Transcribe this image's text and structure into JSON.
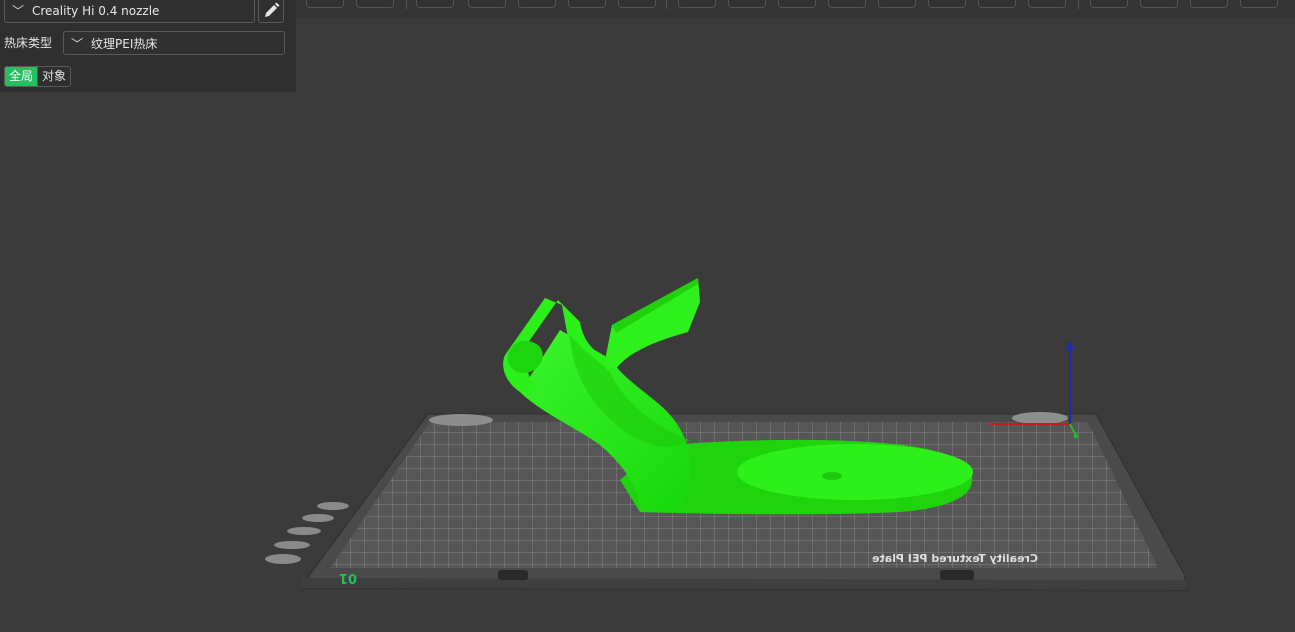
{
  "sidebar": {
    "printer": {
      "value": "Creality Hi 0.4 nozzle"
    },
    "bed_type": {
      "label": "热床类型",
      "value": "纹理PEI热床"
    },
    "scope_toggle": {
      "global": "全局",
      "object": "对象"
    }
  },
  "plate": {
    "number": "01",
    "bed_text": "Creality Textured PEI Plate"
  },
  "colors": {
    "model": "#22e810",
    "accent": "#21c15f",
    "axis_x": "#c0201b",
    "axis_y": "#1fbb2a",
    "axis_z": "#1d2bb0"
  },
  "icons": [
    "chevron-down-icon",
    "pencil-icon"
  ]
}
